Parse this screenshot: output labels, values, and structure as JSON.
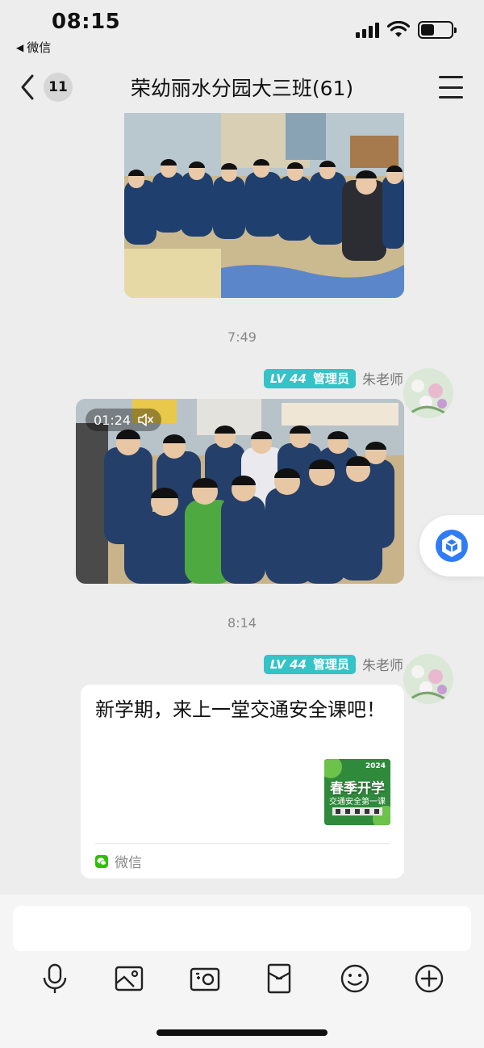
{
  "status_bar": {
    "time": "08:15",
    "back_app_label": "微信",
    "back_app_arrow": "◀"
  },
  "nav": {
    "unread_count": "11",
    "title": "荣幼丽水分园大三班(61)"
  },
  "messages": {
    "timestamp_1": "7:49",
    "timestamp_2": "8:14",
    "sender_1": {
      "level": "LV 44",
      "role": "管理员",
      "name": "朱老师"
    },
    "video": {
      "duration": "01:24"
    },
    "sender_2": {
      "level": "LV 44",
      "role": "管理员",
      "name": "朱老师"
    },
    "card": {
      "text": "新学期，来上一堂交通安全课吧！",
      "thumb_year": "2024",
      "thumb_title": "春季开学",
      "thumb_subtitle": "交通安全第一课",
      "source": "微信"
    }
  },
  "toolbar": {
    "icons": [
      "microphone-icon",
      "image-icon",
      "camera-icon",
      "red-packet-icon",
      "emoji-icon",
      "plus-icon"
    ]
  },
  "colors": {
    "badge_teal": "#34c3c7",
    "wechat_green": "#2dc100",
    "background": "#ededed"
  }
}
